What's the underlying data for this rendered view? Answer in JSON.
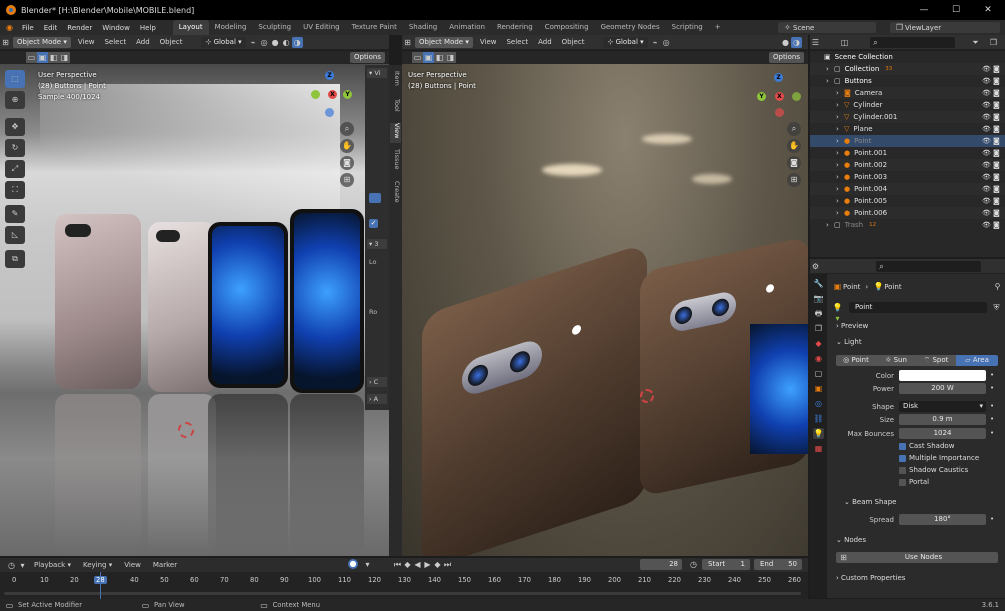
{
  "title_bar": {
    "title": "Blender* [H:\\Blender\\Mobile\\MOBILE.blend]",
    "minimize": "—",
    "maximize": "☐",
    "close": "✕"
  },
  "menu": [
    "File",
    "Edit",
    "Render",
    "Window",
    "Help"
  ],
  "workspaces": [
    "Layout",
    "Modeling",
    "Sculpting",
    "UV Editing",
    "Texture Paint",
    "Shading",
    "Animation",
    "Rendering",
    "Compositing",
    "Geometry Nodes",
    "Scripting"
  ],
  "add_workspace": "+",
  "scene": "Scene",
  "view_layer": "ViewLayer",
  "viewport_left": {
    "mode": "Object Mode",
    "menus": [
      "View",
      "Select",
      "Add",
      "Object"
    ],
    "transform": "Global",
    "options": "Options",
    "overlay": [
      "User Perspective",
      "(28) Buttons | Point",
      "Sample 400/1024"
    ]
  },
  "viewport_right": {
    "mode": "Object Mode",
    "menus": [
      "View",
      "Select",
      "Add",
      "Object"
    ],
    "transform": "Global",
    "options": "Options",
    "overlay": [
      "User Perspective",
      "(28) Buttons | Point"
    ]
  },
  "side_tabs": [
    "Item",
    "Tool",
    "View",
    "Tissue",
    "Create"
  ],
  "npanel": {
    "v_head": "Vi",
    "num_head": "3",
    "lo": "Lo",
    "ro": "Ro",
    "c_head": "C",
    "a_head": "A"
  },
  "outliner": {
    "search_placeholder": "",
    "rows": [
      {
        "name": "Scene Collection",
        "indent": 0,
        "color": "#ffffff"
      },
      {
        "name": "Collection",
        "indent": 1,
        "color": "#ffffff",
        "badge": "33"
      },
      {
        "name": "Buttons",
        "indent": 1,
        "color": "#ffffff"
      },
      {
        "name": "Camera",
        "indent": 2,
        "color": "#e0e0e0"
      },
      {
        "name": "Cylinder",
        "indent": 2,
        "color": "#e0e0e0"
      },
      {
        "name": "Cylinder.001",
        "indent": 2,
        "color": "#e0e0e0"
      },
      {
        "name": "Plane",
        "indent": 2,
        "color": "#e0e0e0"
      },
      {
        "name": "Point",
        "indent": 2,
        "color": "#8a8a8a"
      },
      {
        "name": "Point.001",
        "indent": 2,
        "color": "#e0e0e0"
      },
      {
        "name": "Point.002",
        "indent": 2,
        "color": "#e0e0e0"
      },
      {
        "name": "Point.003",
        "indent": 2,
        "color": "#e0e0e0"
      },
      {
        "name": "Point.004",
        "indent": 2,
        "color": "#e0e0e0"
      },
      {
        "name": "Point.005",
        "indent": 2,
        "color": "#e0e0e0"
      },
      {
        "name": "Point.006",
        "indent": 2,
        "color": "#e0e0e0"
      },
      {
        "name": "Trash",
        "indent": 1,
        "color": "#8a8a8a",
        "badge": "12"
      }
    ]
  },
  "properties": {
    "breadcrumb": [
      "Point",
      "Point"
    ],
    "name": "Point",
    "sections": {
      "preview": "Preview",
      "light": "Light",
      "beam_shape": "Beam Shape",
      "nodes": "Nodes",
      "custom_properties": "Custom Properties"
    },
    "light_types": [
      "Point",
      "Sun",
      "Spot",
      "Area"
    ],
    "active_light_type": "Area",
    "color_label": "Color",
    "color": "#ffffff",
    "power_label": "Power",
    "power": "200 W",
    "shape_label": "Shape",
    "shape": "Disk",
    "size_label": "Size",
    "size": "0.9 m",
    "max_bounces_label": "Max Bounces",
    "max_bounces": "1024",
    "checkboxes": [
      {
        "label": "Cast Shadow",
        "checked": true
      },
      {
        "label": "Multiple Importance",
        "checked": true
      },
      {
        "label": "Shadow Caustics",
        "checked": false
      },
      {
        "label": "Portal",
        "checked": false
      }
    ],
    "spread_label": "Spread",
    "spread": "180°",
    "use_nodes": "Use Nodes"
  },
  "timeline": {
    "menus": [
      "Playback",
      "Keying",
      "View",
      "Marker"
    ],
    "current_frame": "28",
    "start_label": "Start",
    "start": "1",
    "end_label": "End",
    "end": "50",
    "ticks": [
      "0",
      "10",
      "20",
      "28",
      "40",
      "50",
      "60",
      "70",
      "80",
      "90",
      "100",
      "110",
      "120",
      "130",
      "140",
      "150",
      "160",
      "170",
      "180",
      "190",
      "200",
      "210",
      "220",
      "230",
      "240",
      "250",
      "260"
    ]
  },
  "status_bar": {
    "left": "Set Active Modifier",
    "middle": "Pan View",
    "right": "Context Menu",
    "version": "3.6.1"
  },
  "colors": {
    "accent": "#4772b3",
    "orange": "#e87d0d",
    "x_axis": "#e24a4a",
    "y_axis": "#8ec43c",
    "z_axis": "#3d7bd8"
  }
}
